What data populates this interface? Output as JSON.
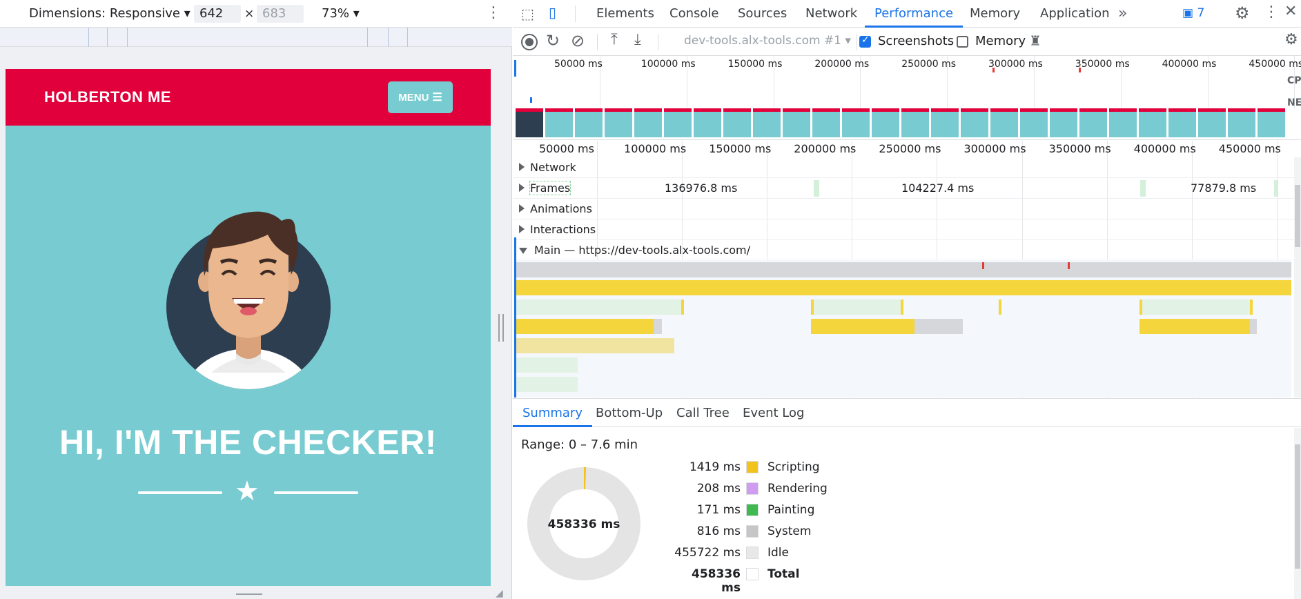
{
  "device_bar": {
    "dimensions_label": "Dimensions: Responsive",
    "width": "642",
    "height": "683",
    "times": "×",
    "zoom": "73%"
  },
  "site": {
    "brand": "HOLBERTON ME",
    "menu_label": "MENU",
    "hero_title": "HI, I'M THE CHECKER!",
    "colors": {
      "nav": "#e1003b",
      "background": "#78ccd1",
      "text": "#ffffff"
    }
  },
  "devtools": {
    "tabs": [
      "Elements",
      "Console",
      "Sources",
      "Network",
      "Performance",
      "Memory",
      "Application"
    ],
    "active_tab": "Performance",
    "more_tabs": "»",
    "issues_count": "7",
    "toolbar": {
      "profile_select": "dev-tools.alx-tools.com #1",
      "screenshots_label": "Screenshots",
      "screenshots_checked": true,
      "memory_label": "Memory",
      "memory_checked": false
    },
    "overview_ticks": [
      "50000 ms",
      "100000 ms",
      "150000 ms",
      "200000 ms",
      "250000 ms",
      "300000 ms",
      "350000 ms",
      "400000 ms",
      "450000 ms"
    ],
    "overview_side_labels": [
      "CPU",
      "NET"
    ],
    "timeline_ticks": [
      "50000 ms",
      "100000 ms",
      "150000 ms",
      "200000 ms",
      "250000 ms",
      "300000 ms",
      "350000 ms",
      "400000 ms",
      "450000 ms"
    ],
    "tracks": {
      "network": "Network",
      "frames": "Frames",
      "frame_durations": [
        "136976.8 ms",
        "104227.4 ms",
        "77879.8 ms"
      ],
      "animations": "Animations",
      "interactions": "Interactions",
      "main": "Main — https://dev-tools.alx-tools.com/"
    },
    "bottom_tabs": [
      "Summary",
      "Bottom-Up",
      "Call Tree",
      "Event Log"
    ],
    "active_bottom_tab": "Summary",
    "summary": {
      "range": "Range: 0 – 7.6 min",
      "total_label": "458336 ms",
      "items": [
        {
          "value": "1419 ms",
          "name": "Scripting",
          "color": "#f2c31c"
        },
        {
          "value": "208 ms",
          "name": "Rendering",
          "color": "#d09cf0"
        },
        {
          "value": "171 ms",
          "name": "Painting",
          "color": "#3fb950"
        },
        {
          "value": "816 ms",
          "name": "System",
          "color": "#c6c6c6"
        },
        {
          "value": "455722 ms",
          "name": "Idle",
          "color": "#e8e8e8"
        },
        {
          "value": "458336 ms",
          "name": "Total",
          "color": "#ffffff"
        }
      ]
    }
  }
}
